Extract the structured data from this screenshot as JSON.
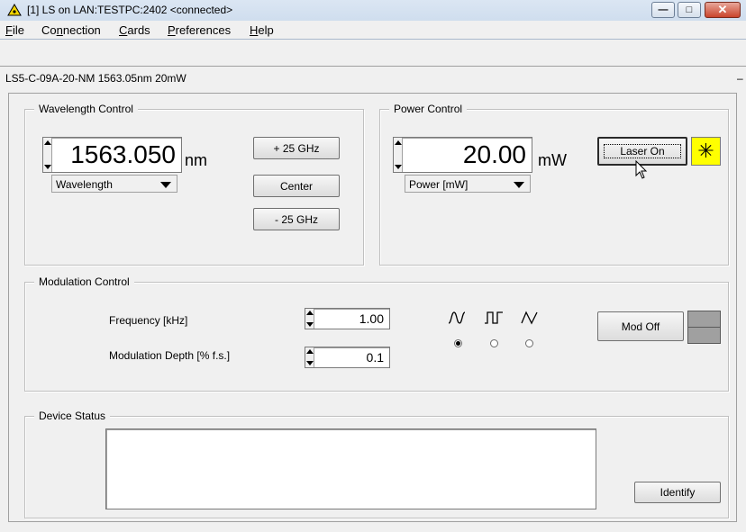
{
  "window": {
    "title": "[1] LS on LAN:TESTPC:2402 <connected>",
    "min_glyph": "—",
    "max_glyph": "□",
    "close_glyph": "✕"
  },
  "menu": [
    {
      "prefix": "",
      "u": "F",
      "rest": "ile"
    },
    {
      "prefix": "Co",
      "u": "n",
      "rest": "nection"
    },
    {
      "prefix": "",
      "u": "C",
      "rest": "ards"
    },
    {
      "prefix": "",
      "u": "P",
      "rest": "references"
    },
    {
      "prefix": "",
      "u": "H",
      "rest": "elp"
    }
  ],
  "model": {
    "name": "LS5-C-09A-20-NM 1563.05nm 20mW",
    "trailing": "–"
  },
  "wavelength": {
    "title": "Wavelength Control",
    "value": "1563.050",
    "unit": "nm",
    "dropdown": "Wavelength",
    "btn_plus": "+ 25 GHz",
    "btn_center": "Center",
    "btn_minus": "- 25 GHz"
  },
  "power": {
    "title": "Power Control",
    "value": "20.00",
    "unit": "mW",
    "dropdown": "Power [mW]",
    "laser_button": "Laser On",
    "laser_indicator_glyph": "✳"
  },
  "modulation": {
    "title": "Modulation Control",
    "frequency_label": "Frequency [kHz]",
    "frequency_value": "1.00",
    "depth_label": "Modulation Depth [% f.s.]",
    "depth_value": "0.1",
    "waveforms": [
      "sine",
      "square",
      "triangle"
    ],
    "selected_waveform": "sine",
    "mod_button": "Mod Off"
  },
  "status": {
    "title": "Device Status",
    "text": "",
    "identify_button": "Identify"
  },
  "colors": {
    "laser_indicator": "#ffff00",
    "mod_indicator": "#a0a0a0"
  }
}
